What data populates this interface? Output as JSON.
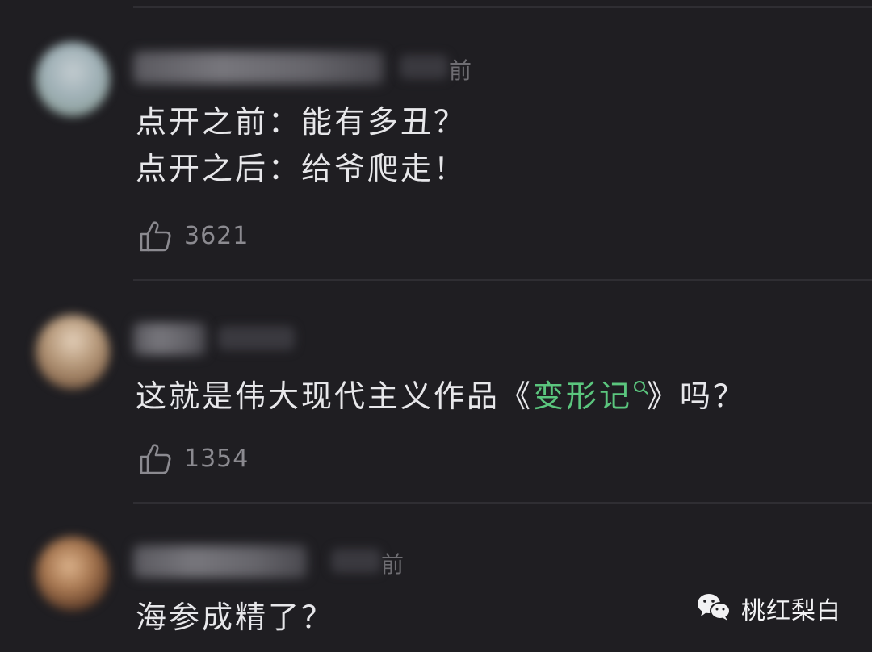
{
  "comments": [
    {
      "time_suffix": "前",
      "lines": [
        "点开之前：能有多丑？",
        "点开之后：给爷爬走！"
      ],
      "likes": "3621"
    },
    {
      "text_before": "这就是伟大现代主义作品《",
      "link_text": "变形记",
      "text_after": "》吗？",
      "likes": "1354"
    },
    {
      "time_suffix": "前",
      "lines": [
        "海参成精了？"
      ]
    }
  ],
  "watermark": {
    "label": "桃红梨白",
    "icon": "wechat-icon"
  },
  "colors": {
    "background": "#1f1e22",
    "text": "#e7e7ea",
    "link": "#5bc67e",
    "muted": "#8b8a90"
  }
}
